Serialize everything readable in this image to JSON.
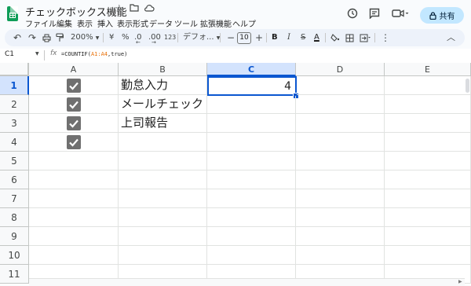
{
  "doc": {
    "title": "チェックボックス機能"
  },
  "menu": [
    "ファイル",
    "編集",
    "表示",
    "挿入",
    "表示形式",
    "データ",
    "ツール",
    "拡張機能",
    "ヘルプ"
  ],
  "share_label": "共有",
  "toolbar": {
    "zoom": "200%",
    "currency": "¥",
    "percent": "%",
    "dec_decrease": ".0",
    "dec_increase": ".00",
    "number_format": "123",
    "font": "デフォ...",
    "font_size": "10",
    "minus": "−",
    "plus": "+",
    "bold": "B",
    "italic": "I",
    "strike": "S",
    "text_color": "A"
  },
  "formula_bar": {
    "cell_ref": "C1",
    "fx": "fx",
    "formula_prefix": "=COUNTIF(",
    "formula_range": "A1:A4",
    "formula_suffix": ",true)"
  },
  "columns": [
    "A",
    "B",
    "C",
    "D",
    "E"
  ],
  "rows": [
    "1",
    "2",
    "3",
    "4",
    "5",
    "6",
    "7",
    "8",
    "9",
    "10",
    "11"
  ],
  "cells": {
    "B1": "勤怠入力",
    "B2": "メールチェック",
    "B3": "上司報告",
    "C1": "4"
  },
  "checkboxes": {
    "A1": true,
    "A2": true,
    "A3": true,
    "A4": true
  },
  "colors": {
    "accent": "#0b57d0",
    "share_bg": "#c2e7ff",
    "checkbox": "#707070",
    "sheets_green": "#0f9d58"
  }
}
